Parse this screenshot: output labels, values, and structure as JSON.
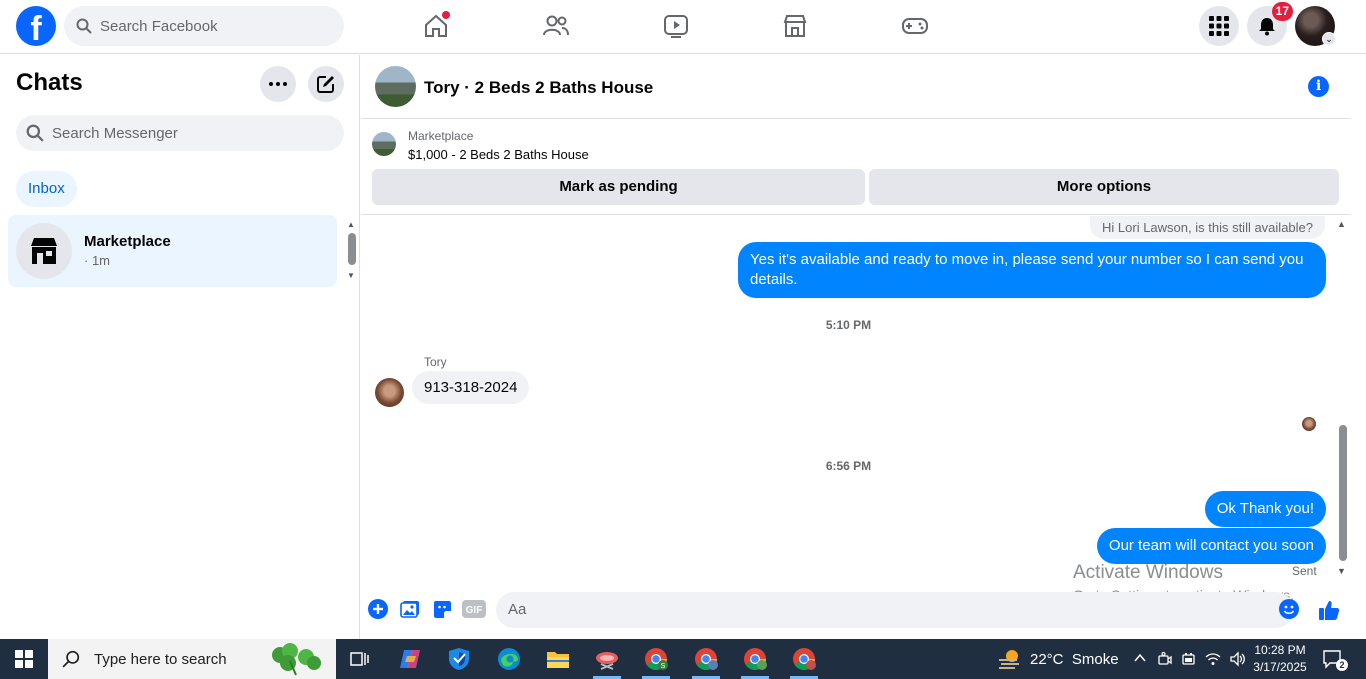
{
  "header": {
    "logo_letter": "f",
    "search_placeholder": "Search Facebook",
    "notifications_count": "17",
    "nav_items": [
      "home-icon",
      "friends-icon",
      "watch-icon",
      "marketplace-icon",
      "gaming-icon"
    ]
  },
  "sidebar": {
    "title": "Chats",
    "search_placeholder": "Search Messenger",
    "filter_label": "Inbox",
    "chats": [
      {
        "name": "Marketplace",
        "meta": "· 1m"
      }
    ]
  },
  "conversation": {
    "title": "Tory · 2 Beds 2 Baths House",
    "listing": {
      "label": "Marketplace",
      "price_title": "$1,000 - 2 Beds 2 Baths House",
      "pending_button": "Mark as pending",
      "more_button": "More options"
    },
    "messages": {
      "first_partial": "Hi Lori Lawson, is this still available?",
      "reply_1": "Yes it's available and ready to move in, please send your number so I can send you details.",
      "time_1": "5:10 PM",
      "sender": "Tory",
      "tory_msg": "913-318-2024",
      "time_2": "6:56 PM",
      "reply_2": "Ok Thank you!",
      "reply_3": "Our team will contact you soon",
      "status": "Sent"
    },
    "composer_placeholder": "Aa",
    "watermark_line1": "Activate Windows",
    "watermark_line2": "Go to Settings to activate Windows."
  },
  "taskbar": {
    "search_placeholder": "Type here to search",
    "weather": "22°C  Smoke",
    "time": "10:28 PM",
    "date": "3/17/2025",
    "notification_count": "2"
  },
  "colors": {
    "facebook_blue": "#0866ff",
    "bubble_blue": "#0084ff",
    "badge_red": "#e41e3f",
    "taskbar": "#1f2e40"
  }
}
